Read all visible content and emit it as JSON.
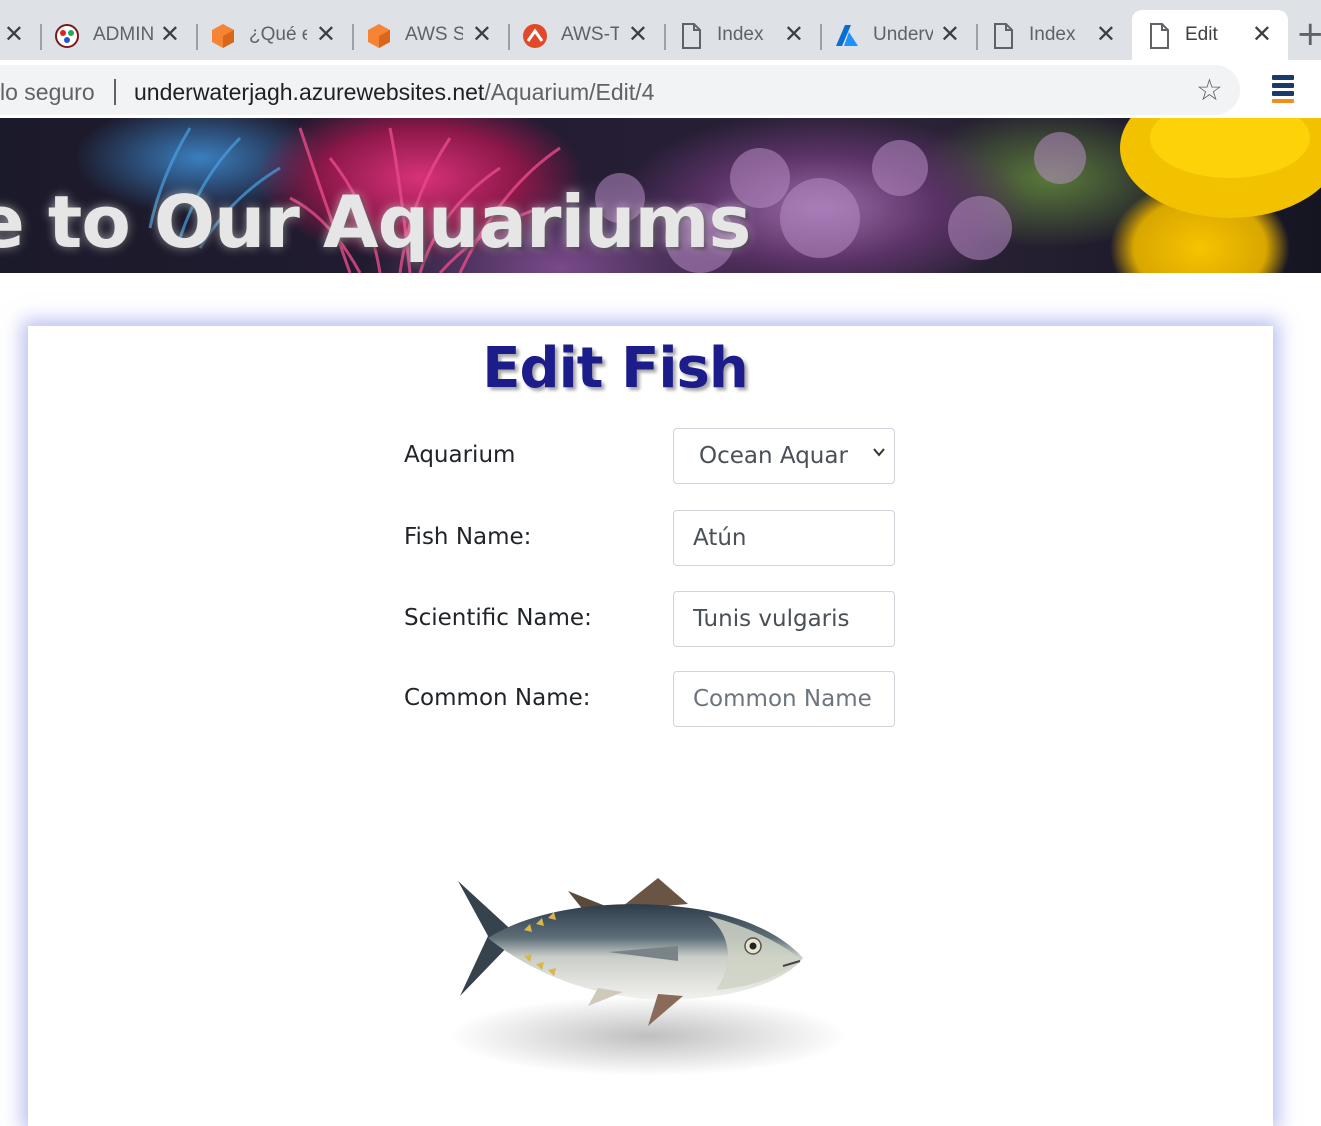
{
  "browser": {
    "tabs": [
      {
        "title": "",
        "favicon": "close-partial"
      },
      {
        "title": "ADMIN",
        "favicon": "admin-logo-icon"
      },
      {
        "title": "¿Qué e",
        "favicon": "aws-cube-icon"
      },
      {
        "title": "AWS Se",
        "favicon": "aws-cube-icon"
      },
      {
        "title": "AWS-TI",
        "favicon": "codeigniter-icon"
      },
      {
        "title": "Index",
        "favicon": "page-icon"
      },
      {
        "title": "Underv",
        "favicon": "azure-icon"
      },
      {
        "title": "Index",
        "favicon": "page-icon"
      },
      {
        "title": "Edit",
        "favicon": "page-icon",
        "active": true
      }
    ],
    "security_label": "lo seguro",
    "url_host": "underwaterjagh.azurewebsites.net",
    "url_path": "/Aquarium/Edit/4"
  },
  "hero": {
    "title": "e to Our Aquariums"
  },
  "page": {
    "title": "Edit Fish",
    "form": {
      "aquarium_label": "Aquarium",
      "aquarium_selected": "Ocean Aquarium",
      "fish_name_label": "Fish Name:",
      "fish_name_value": "Atún",
      "scientific_name_label": "Scientific Name:",
      "scientific_name_value": "Tunis vulgaris",
      "common_name_label": "Common Name:",
      "common_name_value": "",
      "common_name_placeholder": "Common Name"
    }
  },
  "colors": {
    "title": "#1c1c8a",
    "card_glow": "#828ce6"
  }
}
